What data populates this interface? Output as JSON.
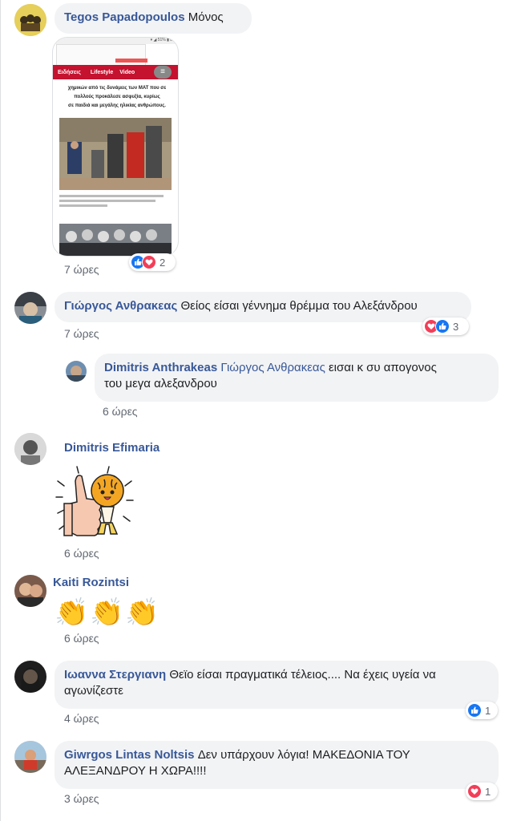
{
  "comments": [
    {
      "name": "Tegos Papadopoulos",
      "text": "Μόνος",
      "time": "7 ώρες",
      "reaction_count": "2"
    },
    {
      "name": "Γιώργος Ανθρακεας",
      "text": "Θείος είσαι γέννημα θρέμμα του Αλεξάνδρου",
      "time": "7 ώρες",
      "reaction_count": "3"
    },
    {
      "name": "Dimitris Anthrakeas",
      "mention": "Γιώργος Ανθρακεας",
      "text_line1": "εισαι κ συ απογονος",
      "text_line2": "του μεγα αλεξανδρου",
      "time": "6 ώρες"
    },
    {
      "name": "Dimitris Efimaria",
      "time": "6 ώρες"
    },
    {
      "name": "Kaiti Rozintsi",
      "time": "6 ώρες",
      "emoji": "👏"
    },
    {
      "name": "Ιωαννα Στεργιανη",
      "text_line1": "Θεϊο είσαι πραγματικά τέλειος.... Να έχεις υγεία να",
      "text_line2": "αγωνίζεστε",
      "time": "4 ώρες",
      "reaction_count": "1"
    },
    {
      "name": "Giwrgos Lintas Noltsis",
      "text_line1": "Δεν υπάρχουν λόγια! ΜΑΚΕΔΟΝΙΑ ΤΟΥ",
      "text_line2": "ΑΛΕΞΑΝΔΡΟΥ Η ΧΩΡΑ!!!!",
      "time": "3 ώρες",
      "reaction_count": "1"
    }
  ],
  "screenshot": {
    "tabs": [
      "Ειδήσεις",
      "Lifestyle",
      "Video"
    ],
    "article_lines": [
      "χημικών από τις δυνάμεις των ΜΑΤ που σε",
      "πολλούς προκάλεσε ασφυξία, κυρίως",
      "σε παιδιά και μεγάλης ηλικίας ανθρώπους."
    ]
  },
  "colors": {
    "link": "#385898",
    "bubble": "#f2f3f5",
    "like": "#1877f2",
    "love": "#f33e58",
    "muted": "#606770"
  }
}
